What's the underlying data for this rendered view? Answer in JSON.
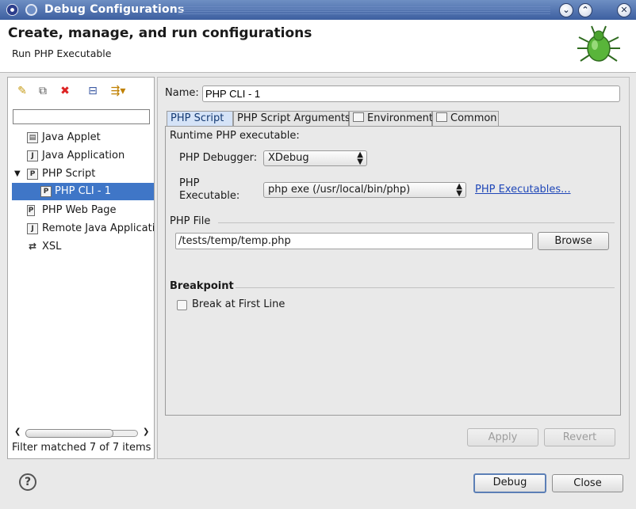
{
  "window": {
    "title": "Debug Configurations",
    "minimize_icon": "chevron-down-icon",
    "maximize_icon": "chevron-up-icon",
    "close_icon": "close-icon"
  },
  "header": {
    "title": "Create, manage, and run configurations",
    "subtitle": "Run PHP Executable",
    "logo_icon": "bug-icon"
  },
  "left_panel": {
    "toolbar": {
      "new_icon": "new-config-icon",
      "duplicate_icon": "duplicate-icon",
      "delete_icon": "delete-icon",
      "collapse_icon": "collapse-all-icon",
      "filter_icon": "filter-icon"
    },
    "filter_value": "",
    "tree": [
      {
        "label": "Java Applet",
        "icon": "java-applet-icon"
      },
      {
        "label": "Java Application",
        "icon": "java-application-icon"
      },
      {
        "label": "PHP Script",
        "icon": "php-script-icon",
        "expanded": true
      },
      {
        "label": "PHP CLI - 1",
        "icon": "php-icon",
        "selected": true
      },
      {
        "label": "PHP Web Page",
        "icon": "php-web-page-icon"
      },
      {
        "label": "Remote Java Applicatio",
        "icon": "remote-java-icon"
      },
      {
        "label": "XSL",
        "icon": "xsl-icon"
      }
    ],
    "status": "Filter matched 7 of 7 items"
  },
  "right_panel": {
    "name_label": "Name:",
    "name_value": "PHP CLI - 1",
    "tabs": [
      {
        "label": "PHP Script",
        "active": true
      },
      {
        "label": "PHP Script Arguments"
      },
      {
        "label": "Environment"
      },
      {
        "label": "Common"
      }
    ],
    "runtime_label": "Runtime PHP executable:",
    "debugger_label": "PHP Debugger:",
    "debugger_value": "XDebug",
    "executable_label_1": "PHP",
    "executable_label_2": "Executable:",
    "executable_value": "php exe (/usr/local/bin/php)",
    "executables_link": "PHP Executables...",
    "php_file_group": "PHP File",
    "php_file_value": "/tests/temp/temp.php",
    "browse_button": "Browse",
    "breakpoint_group": "Breakpoint",
    "break_first_line": "Break at First Line",
    "break_first_line_checked": false,
    "apply_button": "Apply",
    "revert_button": "Revert"
  },
  "footer": {
    "help_icon": "help-icon",
    "help_glyph": "?",
    "debug_button": "Debug",
    "close_button": "Close"
  },
  "colors": {
    "titlebar": "#3d5fa0",
    "selection": "#3f76c7",
    "link": "#1f47b8"
  }
}
